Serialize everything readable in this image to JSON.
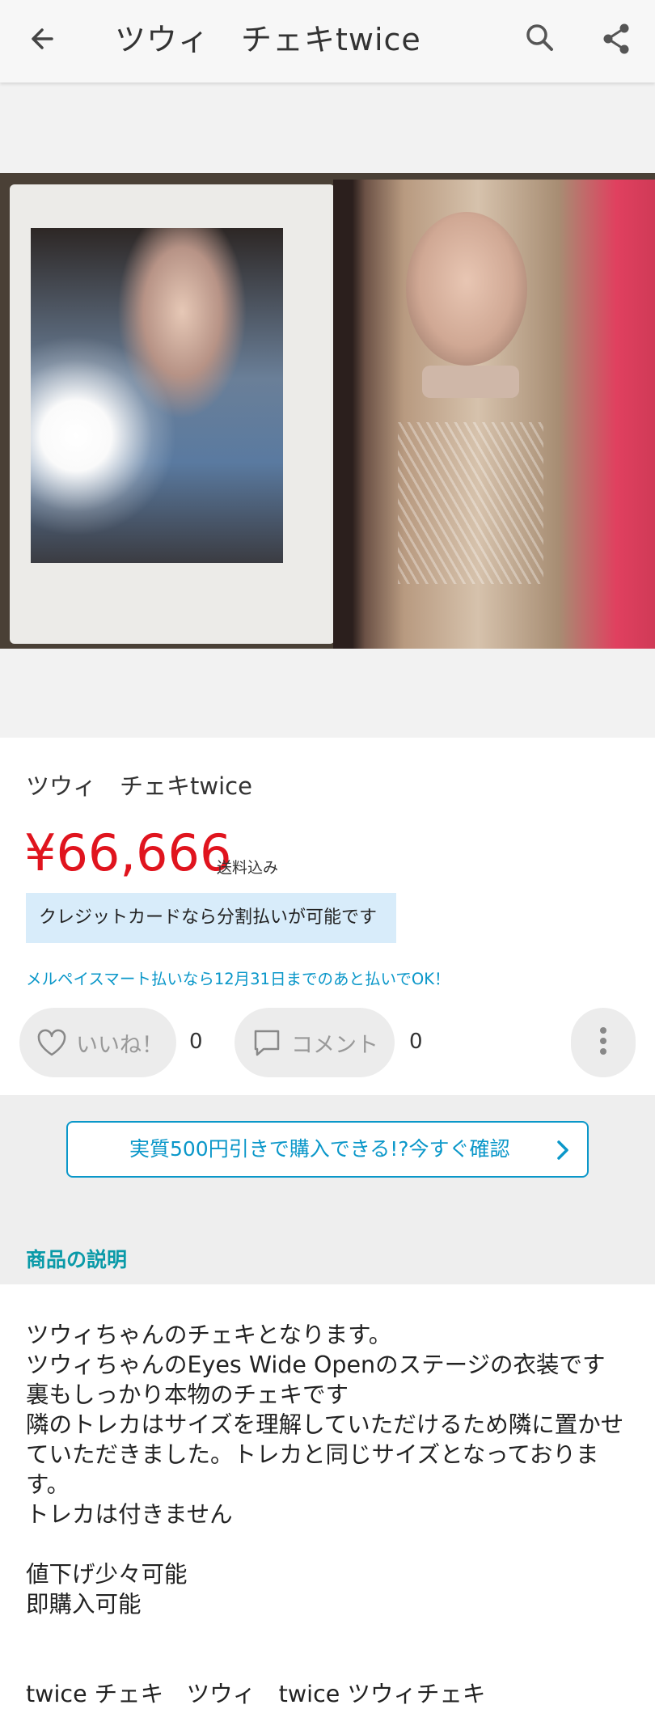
{
  "appbar": {
    "title": "ツウィ　チェキtwice",
    "back_icon": "arrow-left",
    "search_icon": "magnifier",
    "share_icon": "share-nodes"
  },
  "product": {
    "title": "ツウィ　チェキtwice",
    "price": "¥66,666",
    "shipping": "送料込み",
    "credit_notice": "クレジットカードなら分割払いが可能です",
    "merpay_notice": "メルペイスマート払いなら12月31日までのあと払いでOK！"
  },
  "actions": {
    "like_label": "いいね！",
    "like_count": "0",
    "comment_label": "コメント",
    "comment_count": "0",
    "more_icon": "vertical-dots"
  },
  "promo": {
    "label": "実質500円引きで購入できる!?今すぐ確認"
  },
  "description": {
    "heading": "商品の説明",
    "lines": [
      "ツウィちゃんのチェキとなります。",
      "ツウィちゃんのEyes Wide Openのステージの衣装です",
      "裏もしっかり本物のチェキです",
      "隣のトレカはサイズを理解していただけるため隣に置かせていただきました。トレカと同じサイズとなっております。",
      "トレカは付きません",
      "",
      "値下げ少々可能",
      "即購入可能"
    ],
    "tags": "twice チェキ　ツウィ　twice ツウィチェキ"
  },
  "colors": {
    "price_red": "#e0141e",
    "link_blue": "#0a97c9",
    "heading_teal": "#0a9aa8",
    "credit_bg": "#d8ecfa"
  }
}
